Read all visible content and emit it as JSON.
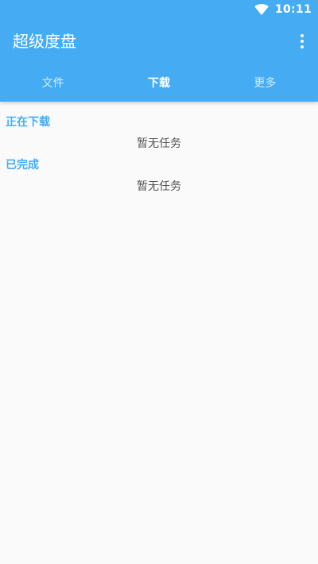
{
  "status_bar": {
    "time": "10:11",
    "wifi_icon": "wifi-icon"
  },
  "app": {
    "title": "超级度盘",
    "menu_icon": "more-vert-icon",
    "accent_color": "#45acf4"
  },
  "tabs": [
    {
      "label": "文件",
      "active": false
    },
    {
      "label": "下载",
      "active": true
    },
    {
      "label": "更多",
      "active": false
    }
  ],
  "sections": {
    "downloading": {
      "header": "正在下载",
      "empty_text": "暂无任务"
    },
    "completed": {
      "header": "已完成",
      "empty_text": "暂无任务"
    }
  }
}
